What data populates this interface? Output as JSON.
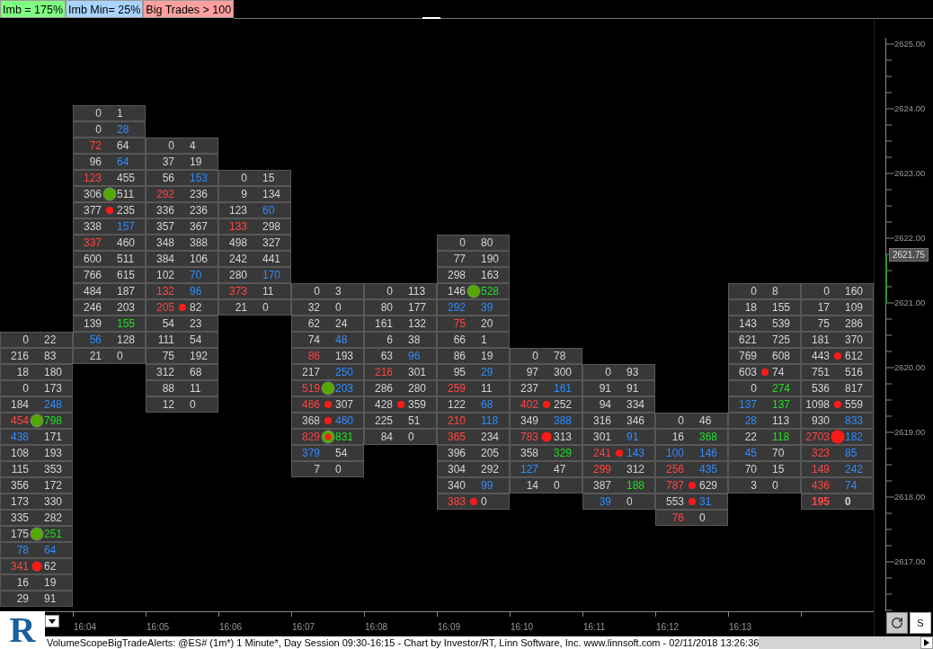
{
  "legend": [
    {
      "label": "Imb = 175%",
      "color": "#80ff80"
    },
    {
      "label": "Imb Min= 25%",
      "color": "#a8d4ff"
    },
    {
      "label": "Big Trades > 100",
      "color": "#ffa0a0"
    }
  ],
  "price_axis": {
    "labels": [
      "2625.00",
      "2624.00",
      "2623.00",
      "2622.00",
      "2621.00",
      "2620.00",
      "2619.00",
      "2618.00",
      "2617.00"
    ],
    "current": "2621.75"
  },
  "columns": [
    {
      "cells": [
        null,
        null,
        null,
        null,
        null,
        null,
        null,
        null,
        null,
        null,
        null,
        null,
        null,
        null,
        {
          "bid": {
            "text": "0"
          },
          "ask": {
            "text": "22"
          }
        },
        {
          "bid": {
            "text": "216"
          },
          "ask": {
            "text": "83"
          }
        },
        {
          "bid": {
            "text": "18"
          },
          "ask": {
            "text": "180"
          }
        },
        {
          "bid": {
            "text": "0"
          },
          "ask": {
            "text": "173"
          }
        },
        {
          "bid": {
            "text": "184"
          },
          "ask": {
            "text": "248",
            "color": "#2e8bff"
          }
        },
        {
          "bid": {
            "text": "454",
            "color": "#ff4444"
          },
          "ask": {
            "text": "798",
            "color": "#22dd22"
          },
          "marker": {
            "kind": "imbalance"
          }
        },
        {
          "bid": {
            "text": "438",
            "color": "#2e8bff"
          },
          "ask": {
            "text": "171"
          }
        },
        {
          "bid": {
            "text": "108"
          },
          "ask": {
            "text": "193"
          }
        },
        {
          "bid": {
            "text": "115"
          },
          "ask": {
            "text": "353"
          }
        },
        {
          "bid": {
            "text": "356"
          },
          "ask": {
            "text": "172"
          }
        },
        {
          "bid": {
            "text": "173"
          },
          "ask": {
            "text": "330"
          }
        },
        {
          "bid": {
            "text": "335"
          },
          "ask": {
            "text": "282"
          }
        },
        {
          "bid": {
            "text": "175"
          },
          "ask": {
            "text": "251",
            "color": "#22dd22"
          },
          "marker": {
            "kind": "imbalance"
          }
        },
        {
          "bid": {
            "text": "78",
            "color": "#2e8bff"
          },
          "ask": {
            "text": "64",
            "color": "#2e8bff"
          }
        },
        {
          "bid": {
            "text": "341",
            "color": "#ff4444"
          },
          "ask": {
            "text": "62"
          },
          "marker": {
            "kind": "big-trade-medium"
          }
        },
        {
          "bid": {
            "text": "16"
          },
          "ask": {
            "text": "19"
          }
        },
        {
          "bid": {
            "text": "29"
          },
          "ask": {
            "text": "91"
          }
        }
      ]
    },
    {
      "time": "16:04",
      "cells": [
        {
          "bid": {
            "text": "0"
          },
          "ask": {
            "text": "1"
          }
        },
        {
          "bid": {
            "text": "0"
          },
          "ask": {
            "text": "28",
            "color": "#2e8bff"
          }
        },
        {
          "bid": {
            "text": "72",
            "color": "#ff4444"
          },
          "ask": {
            "text": "64"
          }
        },
        {
          "bid": {
            "text": "96"
          },
          "ask": {
            "text": "64",
            "color": "#2e8bff"
          }
        },
        {
          "bid": {
            "text": "123",
            "color": "#ff4444"
          },
          "ask": {
            "text": "455"
          }
        },
        {
          "bid": {
            "text": "306"
          },
          "ask": {
            "text": "511"
          },
          "marker": {
            "kind": "imbalance"
          }
        },
        {
          "bid": {
            "text": "377"
          },
          "ask": {
            "text": "235"
          },
          "marker": {
            "kind": "big-trade"
          }
        },
        {
          "bid": {
            "text": "338"
          },
          "ask": {
            "text": "157",
            "color": "#2e8bff"
          }
        },
        {
          "bid": {
            "text": "337",
            "color": "#ff4444"
          },
          "ask": {
            "text": "460"
          }
        },
        {
          "bid": {
            "text": "600"
          },
          "ask": {
            "text": "511"
          }
        },
        {
          "bid": {
            "text": "766"
          },
          "ask": {
            "text": "615"
          }
        },
        {
          "bid": {
            "text": "484"
          },
          "ask": {
            "text": "187"
          }
        },
        {
          "bid": {
            "text": "246"
          },
          "ask": {
            "text": "203"
          }
        },
        {
          "bid": {
            "text": "139"
          },
          "ask": {
            "text": "155",
            "color": "#22dd22"
          }
        },
        {
          "bid": {
            "text": "56",
            "color": "#2e8bff"
          },
          "ask": {
            "text": "128"
          }
        },
        {
          "bid": {
            "text": "21"
          },
          "ask": {
            "text": "0"
          }
        }
      ]
    },
    {
      "time": "16:05",
      "cells": [
        null,
        null,
        {
          "bid": {
            "text": "0"
          },
          "ask": {
            "text": "4"
          }
        },
        {
          "bid": {
            "text": "37"
          },
          "ask": {
            "text": "19"
          }
        },
        {
          "bid": {
            "text": "56"
          },
          "ask": {
            "text": "153",
            "color": "#2e8bff"
          }
        },
        {
          "bid": {
            "text": "292",
            "color": "#ff4444"
          },
          "ask": {
            "text": "236"
          }
        },
        {
          "bid": {
            "text": "336"
          },
          "ask": {
            "text": "236"
          }
        },
        {
          "bid": {
            "text": "357"
          },
          "ask": {
            "text": "367"
          }
        },
        {
          "bid": {
            "text": "348"
          },
          "ask": {
            "text": "388"
          }
        },
        {
          "bid": {
            "text": "384"
          },
          "ask": {
            "text": "106"
          }
        },
        {
          "bid": {
            "text": "102"
          },
          "ask": {
            "text": "70",
            "color": "#2e8bff"
          }
        },
        {
          "bid": {
            "text": "132",
            "color": "#ff4444"
          },
          "ask": {
            "text": "96",
            "color": "#2e8bff"
          }
        },
        {
          "bid": {
            "text": "205",
            "color": "#ff4444"
          },
          "ask": {
            "text": "82"
          },
          "marker": {
            "kind": "big-trade"
          }
        },
        {
          "bid": {
            "text": "54"
          },
          "ask": {
            "text": "23"
          }
        },
        {
          "bid": {
            "text": "111"
          },
          "ask": {
            "text": "54"
          }
        },
        {
          "bid": {
            "text": "75"
          },
          "ask": {
            "text": "192"
          }
        },
        {
          "bid": {
            "text": "312"
          },
          "ask": {
            "text": "68"
          }
        },
        {
          "bid": {
            "text": "88"
          },
          "ask": {
            "text": "11"
          }
        },
        {
          "bid": {
            "text": "12"
          },
          "ask": {
            "text": "0"
          }
        }
      ]
    },
    {
      "time": "16:06",
      "cells": [
        null,
        null,
        null,
        null,
        {
          "bid": {
            "text": "0"
          },
          "ask": {
            "text": "15"
          }
        },
        {
          "bid": {
            "text": "9"
          },
          "ask": {
            "text": "134"
          }
        },
        {
          "bid": {
            "text": "123"
          },
          "ask": {
            "text": "60",
            "color": "#2e8bff"
          }
        },
        {
          "bid": {
            "text": "133",
            "color": "#ff4444"
          },
          "ask": {
            "text": "298"
          }
        },
        {
          "bid": {
            "text": "498"
          },
          "ask": {
            "text": "327"
          }
        },
        {
          "bid": {
            "text": "242"
          },
          "ask": {
            "text": "441"
          }
        },
        {
          "bid": {
            "text": "280"
          },
          "ask": {
            "text": "170",
            "color": "#2e8bff"
          }
        },
        {
          "bid": {
            "text": "373",
            "color": "#ff4444"
          },
          "ask": {
            "text": "11"
          }
        },
        {
          "bid": {
            "text": "21"
          },
          "ask": {
            "text": "0"
          }
        }
      ]
    },
    {
      "time": "16:07",
      "cells": [
        null,
        null,
        null,
        null,
        null,
        null,
        null,
        null,
        null,
        null,
        null,
        {
          "bid": {
            "text": "0"
          },
          "ask": {
            "text": "3"
          }
        },
        {
          "bid": {
            "text": "32"
          },
          "ask": {
            "text": "0"
          }
        },
        {
          "bid": {
            "text": "62"
          },
          "ask": {
            "text": "24"
          }
        },
        {
          "bid": {
            "text": "74"
          },
          "ask": {
            "text": "48",
            "color": "#2e8bff"
          }
        },
        {
          "bid": {
            "text": "86",
            "color": "#ff4444"
          },
          "ask": {
            "text": "193"
          }
        },
        {
          "bid": {
            "text": "217"
          },
          "ask": {
            "text": "250",
            "color": "#2e8bff"
          }
        },
        {
          "bid": {
            "text": "519",
            "color": "#ff4444"
          },
          "ask": {
            "text": "203",
            "color": "#2e8bff"
          },
          "marker": {
            "kind": "imbalance"
          }
        },
        {
          "bid": {
            "text": "466",
            "color": "#ff4444"
          },
          "ask": {
            "text": "307"
          },
          "marker": {
            "kind": "big-trade"
          }
        },
        {
          "bid": {
            "text": "368"
          },
          "ask": {
            "text": "460",
            "color": "#2e8bff"
          },
          "marker": {
            "kind": "big-trade"
          }
        },
        {
          "bid": {
            "text": "829",
            "color": "#ff4444"
          },
          "ask": {
            "text": "831",
            "color": "#22dd22"
          },
          "marker": {
            "kind": "imbalance-big-trade"
          }
        },
        {
          "bid": {
            "text": "379",
            "color": "#2e8bff"
          },
          "ask": {
            "text": "54"
          }
        },
        {
          "bid": {
            "text": "7"
          },
          "ask": {
            "text": "0"
          }
        }
      ]
    },
    {
      "time": "16:08",
      "cells": [
        null,
        null,
        null,
        null,
        null,
        null,
        null,
        null,
        null,
        null,
        null,
        {
          "bid": {
            "text": "0"
          },
          "ask": {
            "text": "113"
          }
        },
        {
          "bid": {
            "text": "80"
          },
          "ask": {
            "text": "177"
          }
        },
        {
          "bid": {
            "text": "161"
          },
          "ask": {
            "text": "132"
          }
        },
        {
          "bid": {
            "text": "6"
          },
          "ask": {
            "text": "38"
          }
        },
        {
          "bid": {
            "text": "63"
          },
          "ask": {
            "text": "96",
            "color": "#2e8bff"
          }
        },
        {
          "bid": {
            "text": "216",
            "color": "#ff4444"
          },
          "ask": {
            "text": "301"
          }
        },
        {
          "bid": {
            "text": "286"
          },
          "ask": {
            "text": "280"
          }
        },
        {
          "bid": {
            "text": "428"
          },
          "ask": {
            "text": "359"
          },
          "marker": {
            "kind": "big-trade"
          }
        },
        {
          "bid": {
            "text": "225"
          },
          "ask": {
            "text": "51"
          }
        },
        {
          "bid": {
            "text": "84"
          },
          "ask": {
            "text": "0"
          }
        }
      ]
    },
    {
      "time": "16:09",
      "cells": [
        null,
        null,
        null,
        null,
        null,
        null,
        null,
        null,
        {
          "bid": {
            "text": "0"
          },
          "ask": {
            "text": "80"
          }
        },
        {
          "bid": {
            "text": "77"
          },
          "ask": {
            "text": "190"
          }
        },
        {
          "bid": {
            "text": "298"
          },
          "ask": {
            "text": "163"
          }
        },
        {
          "bid": {
            "text": "146"
          },
          "ask": {
            "text": "528",
            "color": "#22dd22"
          },
          "marker": {
            "kind": "imbalance"
          }
        },
        {
          "bid": {
            "text": "292",
            "color": "#2e8bff"
          },
          "ask": {
            "text": "39",
            "color": "#2e8bff"
          }
        },
        {
          "bid": {
            "text": "75",
            "color": "#ff4444"
          },
          "ask": {
            "text": "20"
          }
        },
        {
          "bid": {
            "text": "66"
          },
          "ask": {
            "text": "1"
          }
        },
        {
          "bid": {
            "text": "86"
          },
          "ask": {
            "text": "19"
          }
        },
        {
          "bid": {
            "text": "95"
          },
          "ask": {
            "text": "29",
            "color": "#2e8bff"
          }
        },
        {
          "bid": {
            "text": "259",
            "color": "#ff4444"
          },
          "ask": {
            "text": "11"
          }
        },
        {
          "bid": {
            "text": "122"
          },
          "ask": {
            "text": "68",
            "color": "#2e8bff"
          }
        },
        {
          "bid": {
            "text": "210",
            "color": "#ff4444"
          },
          "ask": {
            "text": "118",
            "color": "#2e8bff"
          }
        },
        {
          "bid": {
            "text": "365",
            "color": "#ff4444"
          },
          "ask": {
            "text": "234"
          }
        },
        {
          "bid": {
            "text": "396"
          },
          "ask": {
            "text": "205"
          }
        },
        {
          "bid": {
            "text": "304"
          },
          "ask": {
            "text": "292"
          }
        },
        {
          "bid": {
            "text": "340"
          },
          "ask": {
            "text": "99",
            "color": "#2e8bff"
          }
        },
        {
          "bid": {
            "text": "383",
            "color": "#ff4444"
          },
          "ask": {
            "text": "0"
          },
          "marker": {
            "kind": "big-trade"
          }
        }
      ]
    },
    {
      "time": "16:10",
      "cells": [
        null,
        null,
        null,
        null,
        null,
        null,
        null,
        null,
        null,
        null,
        null,
        null,
        null,
        null,
        null,
        {
          "bid": {
            "text": "0"
          },
          "ask": {
            "text": "78"
          }
        },
        {
          "bid": {
            "text": "97"
          },
          "ask": {
            "text": "300"
          }
        },
        {
          "bid": {
            "text": "237"
          },
          "ask": {
            "text": "161",
            "color": "#2e8bff"
          }
        },
        {
          "bid": {
            "text": "402",
            "color": "#ff4444"
          },
          "ask": {
            "text": "252"
          },
          "marker": {
            "kind": "big-trade"
          }
        },
        {
          "bid": {
            "text": "349"
          },
          "ask": {
            "text": "388",
            "color": "#2e8bff"
          }
        },
        {
          "bid": {
            "text": "783",
            "color": "#ff4444"
          },
          "ask": {
            "text": "313"
          },
          "marker": {
            "kind": "big-trade-medium"
          }
        },
        {
          "bid": {
            "text": "358"
          },
          "ask": {
            "text": "329",
            "color": "#22dd22"
          }
        },
        {
          "bid": {
            "text": "127",
            "color": "#2e8bff"
          },
          "ask": {
            "text": "47"
          }
        },
        {
          "bid": {
            "text": "14"
          },
          "ask": {
            "text": "0"
          }
        }
      ]
    },
    {
      "time": "16:11",
      "cells": [
        null,
        null,
        null,
        null,
        null,
        null,
        null,
        null,
        null,
        null,
        null,
        null,
        null,
        null,
        null,
        null,
        {
          "bid": {
            "text": "0"
          },
          "ask": {
            "text": "93"
          }
        },
        {
          "bid": {
            "text": "91"
          },
          "ask": {
            "text": "91"
          }
        },
        {
          "bid": {
            "text": "94"
          },
          "ask": {
            "text": "334"
          }
        },
        {
          "bid": {
            "text": "316"
          },
          "ask": {
            "text": "346"
          }
        },
        {
          "bid": {
            "text": "301"
          },
          "ask": {
            "text": "91",
            "color": "#2e8bff"
          }
        },
        {
          "bid": {
            "text": "241",
            "color": "#ff4444"
          },
          "ask": {
            "text": "143",
            "color": "#2e8bff"
          },
          "marker": {
            "kind": "big-trade"
          }
        },
        {
          "bid": {
            "text": "299",
            "color": "#ff4444"
          },
          "ask": {
            "text": "312"
          }
        },
        {
          "bid": {
            "text": "387"
          },
          "ask": {
            "text": "188",
            "color": "#22dd22"
          }
        },
        {
          "bid": {
            "text": "39",
            "color": "#2e8bff"
          },
          "ask": {
            "text": "0"
          }
        }
      ]
    },
    {
      "time": "16:12",
      "cells": [
        null,
        null,
        null,
        null,
        null,
        null,
        null,
        null,
        null,
        null,
        null,
        null,
        null,
        null,
        null,
        null,
        null,
        null,
        null,
        {
          "bid": {
            "text": "0"
          },
          "ask": {
            "text": "46"
          }
        },
        {
          "bid": {
            "text": "16"
          },
          "ask": {
            "text": "368",
            "color": "#22dd22"
          }
        },
        {
          "bid": {
            "text": "100",
            "color": "#2e8bff"
          },
          "ask": {
            "text": "146",
            "color": "#2e8bff"
          }
        },
        {
          "bid": {
            "text": "256",
            "color": "#ff4444"
          },
          "ask": {
            "text": "435",
            "color": "#2e8bff"
          }
        },
        {
          "bid": {
            "text": "787",
            "color": "#ff4444"
          },
          "ask": {
            "text": "629"
          },
          "marker": {
            "kind": "big-trade"
          }
        },
        {
          "bid": {
            "text": "553"
          },
          "ask": {
            "text": "31",
            "color": "#2e8bff"
          },
          "marker": {
            "kind": "big-trade"
          }
        },
        {
          "bid": {
            "text": "76",
            "color": "#ff4444"
          },
          "ask": {
            "text": "0"
          }
        }
      ]
    },
    {
      "time": "16:13",
      "cells": [
        null,
        null,
        null,
        null,
        null,
        null,
        null,
        null,
        null,
        null,
        null,
        {
          "bid": {
            "text": "0"
          },
          "ask": {
            "text": "8"
          }
        },
        {
          "bid": {
            "text": "18"
          },
          "ask": {
            "text": "155"
          }
        },
        {
          "bid": {
            "text": "143"
          },
          "ask": {
            "text": "539"
          }
        },
        {
          "bid": {
            "text": "621"
          },
          "ask": {
            "text": "725"
          }
        },
        {
          "bid": {
            "text": "769"
          },
          "ask": {
            "text": "608"
          }
        },
        {
          "bid": {
            "text": "603"
          },
          "ask": {
            "text": "74"
          },
          "marker": {
            "kind": "big-trade"
          }
        },
        {
          "bid": {
            "text": "0"
          },
          "ask": {
            "text": "274",
            "color": "#22dd22"
          }
        },
        {
          "bid": {
            "text": "137",
            "color": "#2e8bff"
          },
          "ask": {
            "text": "137",
            "color": "#22dd22"
          }
        },
        {
          "bid": {
            "text": "28",
            "color": "#2e8bff"
          },
          "ask": {
            "text": "113"
          }
        },
        {
          "bid": {
            "text": "22"
          },
          "ask": {
            "text": "118",
            "color": "#22dd22"
          }
        },
        {
          "bid": {
            "text": "45",
            "color": "#2e8bff"
          },
          "ask": {
            "text": "70"
          }
        },
        {
          "bid": {
            "text": "70"
          },
          "ask": {
            "text": "15"
          }
        },
        {
          "bid": {
            "text": "3"
          },
          "ask": {
            "text": "0"
          }
        }
      ]
    },
    {
      "cells": [
        null,
        null,
        null,
        null,
        null,
        null,
        null,
        null,
        null,
        null,
        null,
        {
          "bid": {
            "text": "0"
          },
          "ask": {
            "text": "160"
          }
        },
        {
          "bid": {
            "text": "17"
          },
          "ask": {
            "text": "109"
          }
        },
        {
          "bid": {
            "text": "75"
          },
          "ask": {
            "text": "286"
          }
        },
        {
          "bid": {
            "text": "181"
          },
          "ask": {
            "text": "370"
          }
        },
        {
          "bid": {
            "text": "443"
          },
          "ask": {
            "text": "612"
          },
          "marker": {
            "kind": "big-trade"
          }
        },
        {
          "bid": {
            "text": "751"
          },
          "ask": {
            "text": "516"
          }
        },
        {
          "bid": {
            "text": "536"
          },
          "ask": {
            "text": "817"
          }
        },
        {
          "bid": {
            "text": "1098"
          },
          "ask": {
            "text": "559"
          },
          "marker": {
            "kind": "big-trade"
          }
        },
        {
          "bid": {
            "text": "930"
          },
          "ask": {
            "text": "833",
            "color": "#2e8bff"
          }
        },
        {
          "bid": {
            "text": "2703",
            "color": "#ff4444"
          },
          "ask": {
            "text": "182",
            "color": "#2e8bff"
          },
          "marker": {
            "kind": "big-trade-large"
          }
        },
        {
          "bid": {
            "text": "323",
            "color": "#ff4444"
          },
          "ask": {
            "text": "85",
            "color": "#2e8bff"
          }
        },
        {
          "bid": {
            "text": "149",
            "color": "#ff4444"
          },
          "ask": {
            "text": "242",
            "color": "#2e8bff"
          }
        },
        {
          "bid": {
            "text": "436",
            "color": "#ff4444"
          },
          "ask": {
            "text": "74",
            "color": "#2e8bff"
          }
        },
        {
          "bid": {
            "text": "195",
            "color": "#ff4444"
          },
          "ask": {
            "text": "0"
          },
          "bold": true
        }
      ]
    }
  ],
  "logo": "R",
  "s_button": "S",
  "status": "VolumeScopeBigTradeAlerts: @ES# (1m*) 1 Minute*, Day Session 09:30-16:15 - Chart by Investor/RT, Linn Software, Inc. www.linnsoft.com - 02/11/2018 13:26:36"
}
